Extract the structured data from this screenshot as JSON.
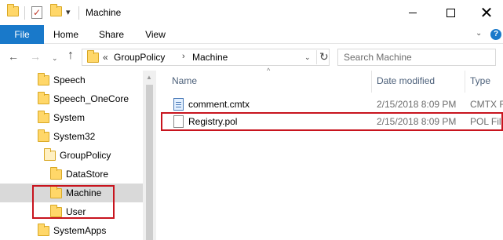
{
  "window": {
    "title": "Machine",
    "quick_access_icons": [
      "folder-icon",
      "properties-icon",
      "new-folder-icon"
    ],
    "qa_dropdown_glyph": "▾",
    "minimize_glyph": "",
    "close_glyph": "✕"
  },
  "ribbon": {
    "tabs": [
      "File",
      "Home",
      "Share",
      "View"
    ],
    "expand_glyph": "⌄",
    "help_glyph": "?"
  },
  "nav": {
    "back_glyph": "←",
    "forward_glyph": "→",
    "recent_glyph": "⌄",
    "up_glyph": "↑"
  },
  "address": {
    "overflow": "«",
    "segments": [
      "GroupPolicy",
      "Machine"
    ],
    "separator": "›",
    "dropdown_glyph": "⌄",
    "refresh_glyph": "↻"
  },
  "search": {
    "placeholder": "Search Machine"
  },
  "tree": {
    "items": [
      {
        "label": "Speech"
      },
      {
        "label": "Speech_OneCore"
      },
      {
        "label": "System"
      },
      {
        "label": "System32"
      },
      {
        "label": "GroupPolicy"
      },
      {
        "label": "DataStore"
      },
      {
        "label": "Machine"
      },
      {
        "label": "User"
      },
      {
        "label": "SystemApps"
      }
    ],
    "scroll_up_glyph": "▲"
  },
  "files": {
    "sort_glyph": "^",
    "columns": [
      "Name",
      "Date modified",
      "Type"
    ],
    "rows": [
      {
        "name": "comment.cmtx",
        "date": "2/15/2018 8:09 PM",
        "type": "CMTX F"
      },
      {
        "name": "Registry.pol",
        "date": "2/15/2018 8:09 PM",
        "type": "POL File"
      }
    ]
  },
  "colors": {
    "accent": "#1979ca",
    "folder": "#ffd769",
    "annotation": "#c8141e",
    "selection": "#d9d9d9"
  }
}
